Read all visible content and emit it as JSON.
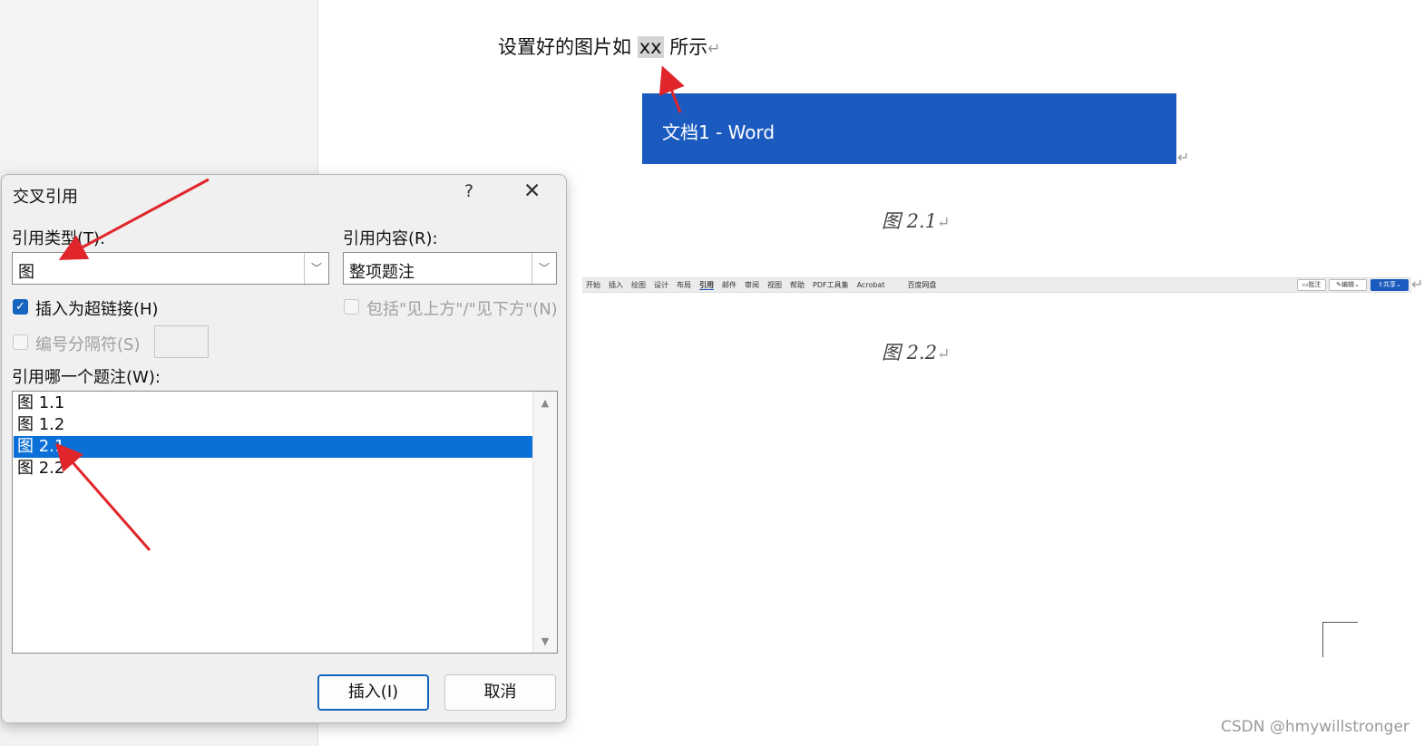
{
  "document": {
    "line_before": "设置好的图片如",
    "line_highlight": "xx",
    "line_after": "所示",
    "paragraph_mark": "↵",
    "image_title_text": "文档1  -  Word",
    "caption_1": "图 2.1",
    "caption_2": "图 2.2"
  },
  "ribbon": {
    "tabs": [
      "开始",
      "插入",
      "绘图",
      "设计",
      "布局",
      "引用",
      "邮件",
      "审阅",
      "视图",
      "帮助",
      "PDF工具集",
      "Acrobat",
      "百度网盘"
    ],
    "active_tab": "引用",
    "comment_label": "批注",
    "edit_label": "编辑",
    "share_label": "共享"
  },
  "dialog": {
    "title": "交叉引用",
    "help": "?",
    "close": "✕",
    "ref_type_label": "引用类型(T):",
    "ref_type_value": "图",
    "ref_content_label": "引用内容(R):",
    "ref_content_value": "整项题注",
    "hyperlink_label": "插入为超链接(H)",
    "hyperlink_checked": true,
    "include_label": "包括\"见上方\"/\"见下方\"(N)",
    "separator_label": "编号分隔符(S)",
    "which_label": "引用哪一个题注(W):",
    "items": [
      "图 1.1",
      "图 1.2",
      "图 2.1",
      "图 2.2"
    ],
    "selected_index": 2,
    "insert_button": "插入(I)",
    "cancel_button": "取消"
  },
  "watermark": "CSDN @hmywillstronger",
  "colors": {
    "accent": "#1b5bbf",
    "selection": "#0a6fd6",
    "arrow": "#e0262b"
  },
  "icons": {
    "dropdown": "chevron-down-icon",
    "check": "check-icon",
    "close": "close-icon"
  }
}
